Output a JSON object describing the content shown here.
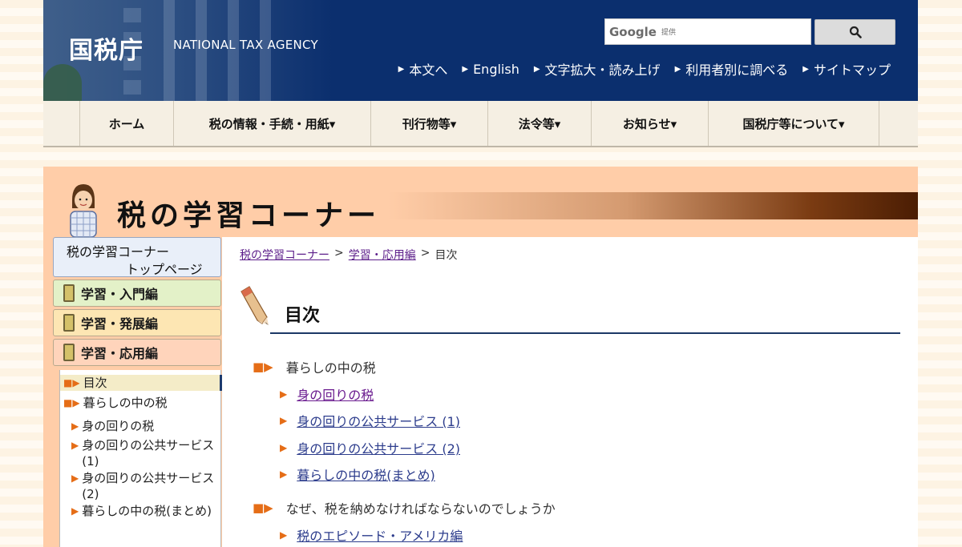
{
  "header": {
    "logo_jp": "国税庁",
    "logo_en": "NATIONAL TAX AGENCY",
    "search_brand": "Google",
    "search_sub": "提供",
    "util_links": [
      "本文へ",
      "English",
      "文字拡大・読み上げ",
      "利用者別に調べる",
      "サイトマップ"
    ]
  },
  "nav": {
    "items": [
      {
        "label": "ホーム"
      },
      {
        "label": "税の情報・手続・用紙▾"
      },
      {
        "label": "刊行物等▾"
      },
      {
        "label": "法令等▾"
      },
      {
        "label": "お知らせ▾"
      },
      {
        "label": "国税庁等について▾"
      }
    ]
  },
  "banner": {
    "title": "税の学習コーナー"
  },
  "sidebar": {
    "top_line1": "税の学習コーナー",
    "top_line2": "トップページ",
    "categories": [
      {
        "label": "学習・入門編",
        "bg": "#e3f1c8"
      },
      {
        "label": "学習・発展編",
        "bg": "#fde6b3"
      },
      {
        "label": "学習・応用編",
        "bg": "#ffd4bb"
      }
    ],
    "list": [
      {
        "label": "目次"
      },
      {
        "label": "暮らしの中の税"
      },
      {
        "label": "身の回りの税"
      },
      {
        "label": "身の回りの公共サービス(1)"
      },
      {
        "label": "身の回りの公共サービス(2)"
      },
      {
        "label": "暮らしの中の税(まとめ)"
      }
    ]
  },
  "breadcrumb": {
    "items": [
      "税の学習コーナー",
      "学習・応用編",
      "目次"
    ],
    "sep": ">"
  },
  "main": {
    "heading": "目次",
    "sections": [
      {
        "title": "暮らしの中の税",
        "links": [
          "身の回りの税",
          "身の回りの公共サービス (1)",
          "身の回りの公共サービス (2)",
          "暮らしの中の税(まとめ)"
        ]
      },
      {
        "title": "なぜ、税を納めなければならないのでしょうか",
        "links": [
          "税のエピソード・アメリカ編"
        ]
      }
    ]
  },
  "colors": {
    "header_bg": "#0b2f6e",
    "accent_orange": "#e56d17",
    "content_bg": "#ffcda8",
    "nav_bg": "#f5efe3"
  }
}
